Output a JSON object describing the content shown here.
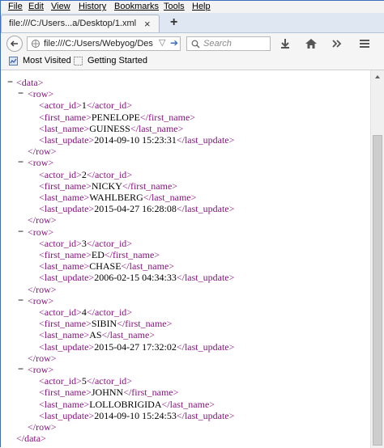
{
  "menu": [
    "File",
    "Edit",
    "View",
    "History",
    "Bookmarks",
    "Tools",
    "Help"
  ],
  "tab": {
    "title": "file:///C:/Users...a/Desktop/1.xml"
  },
  "url": "file:///C:/Users/Webyog/Des",
  "search": {
    "placeholder": "Search"
  },
  "bookmarks": [
    "Most Visited",
    "Getting Started"
  ],
  "icons": {
    "back": "back-arrow-icon",
    "download": "download-icon",
    "home": "home-icon",
    "overflow": "chevron-double-right-icon",
    "menu": "hamburger-menu-icon",
    "go": "go-arrow-icon"
  },
  "colors": {
    "tag": "#881280",
    "text": "#000000",
    "accent": "#3a6cc3"
  },
  "xml": {
    "root_open": "<data>",
    "root_close": "</data>",
    "rows": [
      {
        "actor_id": "1",
        "first_name": "PENELOPE",
        "last_name": "GUINESS",
        "last_update": "2014-09-10 15:23:31"
      },
      {
        "actor_id": "2",
        "first_name": "NICKY",
        "last_name": "WAHLBERG",
        "last_update": "2015-04-27 16:28:08"
      },
      {
        "actor_id": "3",
        "first_name": "ED",
        "last_name": "CHASE",
        "last_update": "2006-02-15 04:34:33"
      },
      {
        "actor_id": "4",
        "first_name": "SIBIN",
        "last_name": "AS",
        "last_update": "2015-04-27 17:32:02"
      },
      {
        "actor_id": "5",
        "first_name": "JOHNN",
        "last_name": "LOLLOBRIGIDA",
        "last_update": "2014-09-10 15:24:53"
      }
    ]
  }
}
